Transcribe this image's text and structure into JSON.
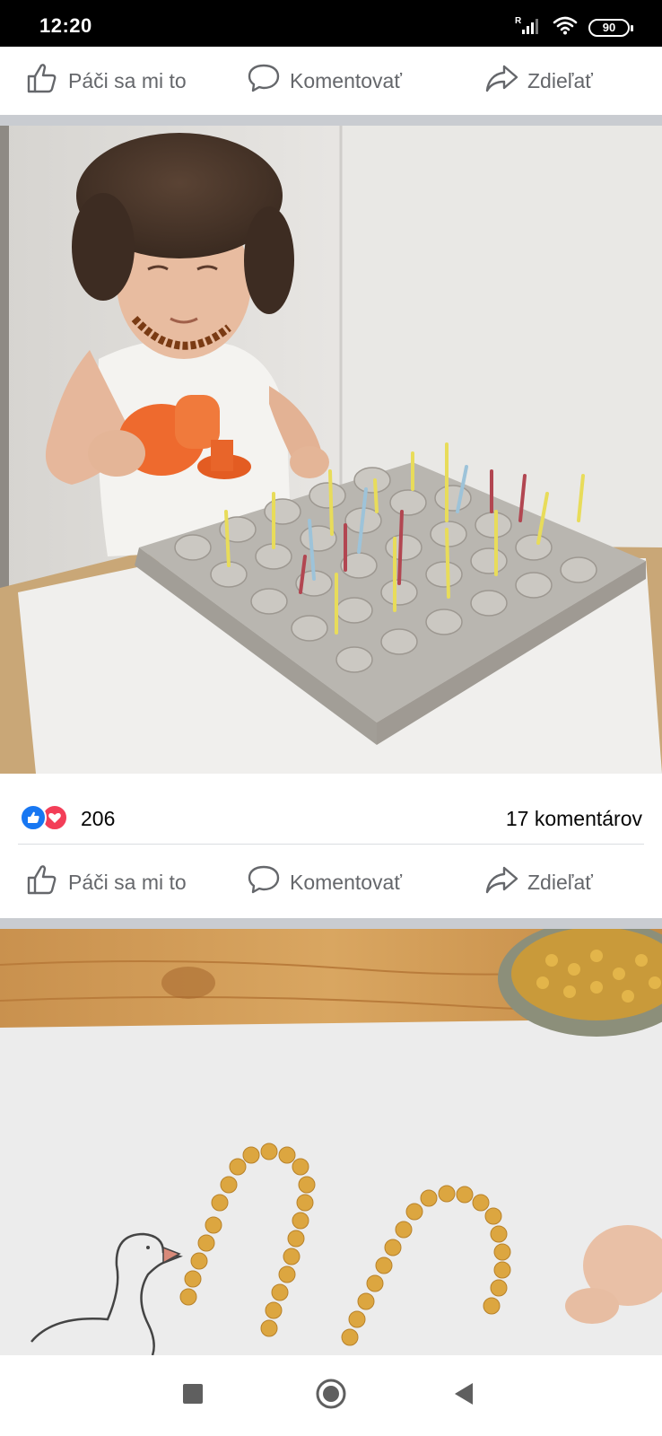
{
  "status_bar": {
    "time": "12:20",
    "signal_label": "R",
    "battery_level": "90",
    "icons": [
      "signal-icon",
      "wifi-icon",
      "battery-icon"
    ]
  },
  "actions": {
    "like_label": "Páči sa mi to",
    "comment_label": "Komentovať",
    "share_label": "Zdieľať"
  },
  "post": {
    "reaction_count": "206",
    "comments_count": "17 komentárov",
    "reaction_types": [
      "like-icon",
      "love-icon"
    ]
  },
  "nav_bar": {
    "buttons": [
      "recents-button",
      "home-button",
      "back-button"
    ]
  },
  "colors": {
    "action_text": "#65676b",
    "like_blue": "#1877f2",
    "love_red": "#f33e58",
    "separator": "#c9ccd1"
  }
}
